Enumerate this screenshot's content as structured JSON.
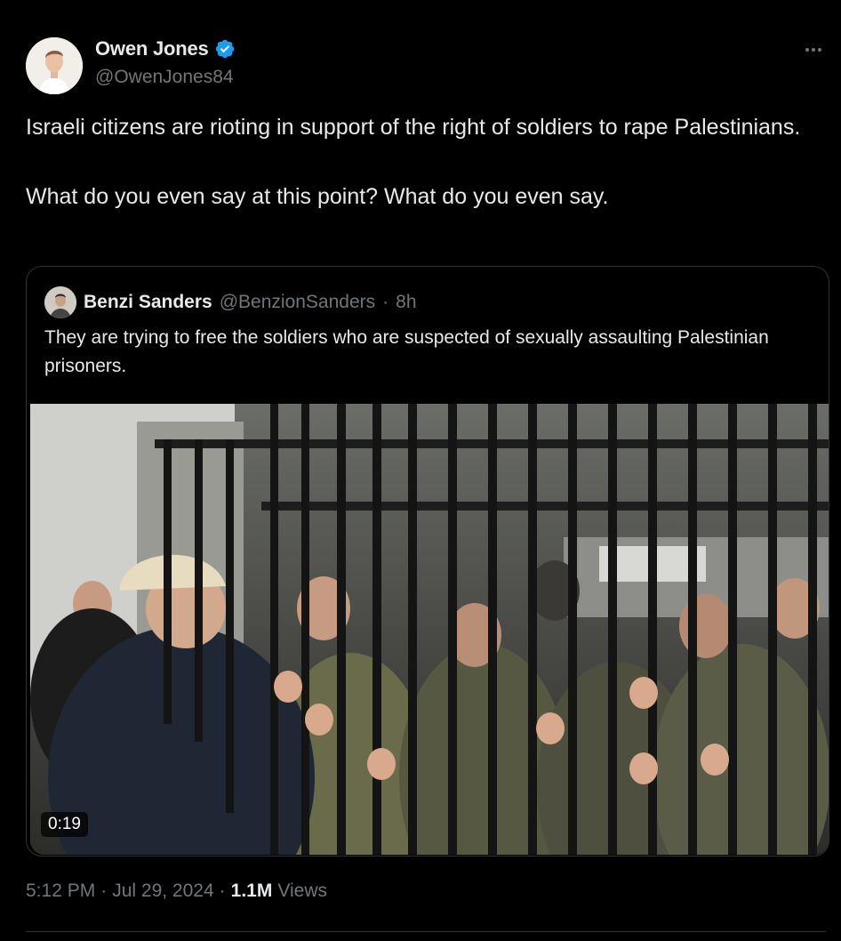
{
  "author": {
    "display_name": "Owen Jones",
    "handle": "@OwenJones84",
    "verified": true,
    "verified_icon": "verified-badge-icon"
  },
  "tweet": {
    "text": "Israeli citizens are rioting in support of the right of soldiers to rape Palestinians.\n\nWhat do you even say at this point? What do you even say."
  },
  "quoted_tweet": {
    "display_name": "Benzi Sanders",
    "handle": "@BenzionSanders",
    "separator": "·",
    "age": "8h",
    "text": "They are trying to free the soldiers who are suspected of sexually assaulting Palestinian prisoners.",
    "media": {
      "duration": "0:19"
    }
  },
  "meta": {
    "time": "5:12 PM",
    "dot": "·",
    "date": "Jul 29, 2024",
    "dot2": "·",
    "views_count": "1.1M",
    "views_label": "Views"
  },
  "colors": {
    "background": "#000000",
    "primary_text": "#e7e9ea",
    "secondary_text": "#71767b",
    "border": "#2f3336",
    "verified": "#1d9bf0"
  }
}
